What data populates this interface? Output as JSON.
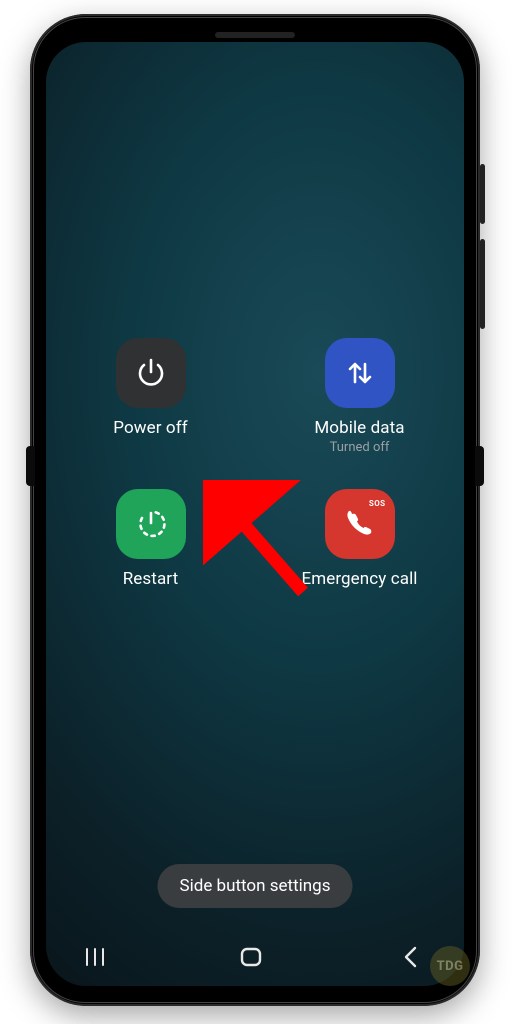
{
  "options": {
    "power_off": {
      "label": "Power off",
      "icon": "power-icon",
      "color": "#2f3133"
    },
    "mobile_data": {
      "label": "Mobile data",
      "sublabel": "Turned off",
      "icon": "updown-icon",
      "color": "#3054c3"
    },
    "restart": {
      "label": "Restart",
      "icon": "restart-icon",
      "color": "#1fa45a"
    },
    "emergency": {
      "label": "Emergency call",
      "icon": "phone-sos-icon",
      "color": "#d5362d",
      "badge": "SOS"
    }
  },
  "bottom_button": {
    "label": "Side button settings"
  },
  "annotation": {
    "arrow_target": "restart",
    "color": "#ff0000"
  },
  "watermark": "TDG",
  "nav": {
    "recents": "recents-icon",
    "home": "home-icon",
    "back": "back-icon"
  }
}
